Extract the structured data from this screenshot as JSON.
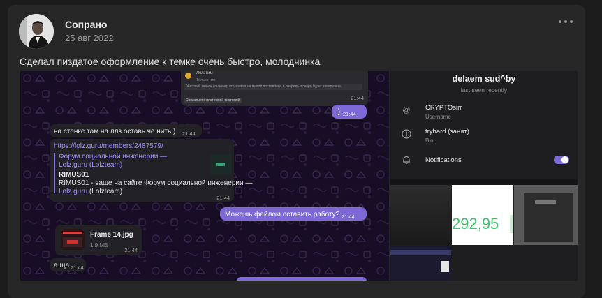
{
  "post": {
    "author": "Сопрано",
    "date": "25 авг 2022",
    "message": "Сделал пиздатое оформление к темке очень быстро, молодчинка"
  },
  "chat": {
    "top_card": {
      "header": "Лолзтим",
      "line1": "Только что",
      "notice": "Жесткий значок означает, что заявка на вывод поставлена в очередь и скоро будет завершена.",
      "button": "Связаться с платежной системой",
      "time": "21:44"
    },
    "smile": {
      "text": ":)",
      "time": "21:44"
    },
    "msg1": {
      "text": "на стенке там на ллз оставь че нить )",
      "time": "21:44"
    },
    "link_msg": {
      "url": "https://lolz.guru/members/2487579/",
      "preview_title": "Форум социальной инженерии — Lolz.guru (Lolzteam)",
      "preview_name": "RIMUS01",
      "preview_desc": "RIMUS01 - ваше на сайте Форум социальной инженерии —",
      "preview_link": "Lolz.guru",
      "preview_suffix": " (Lolzteam)",
      "time": "21:44"
    },
    "msg2": {
      "text": "Можешь файлом оставить работу?",
      "time": "21:44"
    },
    "file": {
      "name": "Frame 14.jpg",
      "size": "1.9 MB",
      "time": "21:44",
      "icon": "image-file-icon"
    },
    "msg3": {
      "text": "а ща",
      "time": "21:44"
    }
  },
  "profile": {
    "name": "delaem sud^by",
    "status": "last seen recently",
    "username": "CRYPTOsirr",
    "username_label": "Username",
    "bio": "tryhard (занят)",
    "bio_label": "Bio",
    "notifications_label": "Notifications",
    "notifications_on": true,
    "media_number": "292,95",
    "accent": "#7c69d6"
  }
}
